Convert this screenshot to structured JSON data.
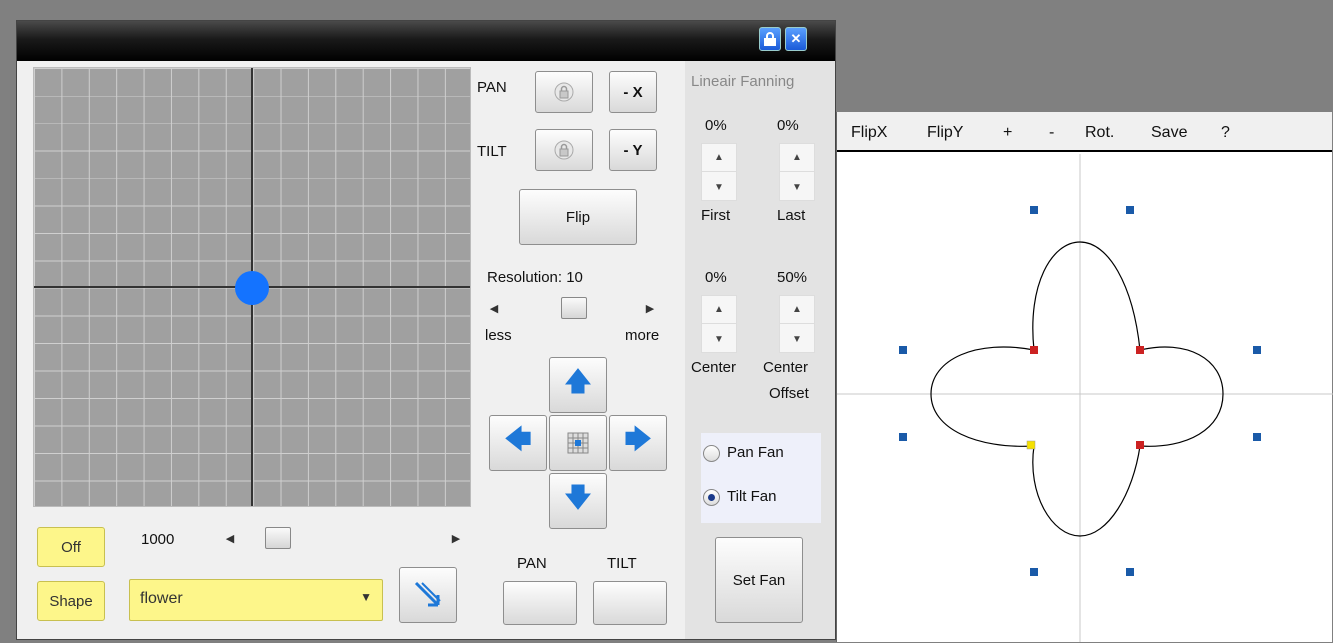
{
  "window": {
    "title_buttons": {
      "lock_icon": "lock-icon",
      "close_icon": "close-icon",
      "close_glyph": "✕"
    }
  },
  "pad": {
    "accent_color": "#1473ff"
  },
  "controls": {
    "pan_label": "PAN",
    "tilt_label": "TILT",
    "minus_x": "- X",
    "minus_y": "- Y",
    "flip": "Flip",
    "resolution_label": "Resolution: 10",
    "less": "less",
    "more": "more",
    "pan_bottom": "PAN",
    "tilt_bottom": "TILT"
  },
  "bottom": {
    "off": "Off",
    "speed_value": "1000",
    "shape": "Shape",
    "shape_selected": "flower",
    "highlight_color": "#fdf68a"
  },
  "fanning": {
    "title": "Lineair Fanning",
    "first_value": "0%",
    "last_value": "0%",
    "first_label": "First",
    "last_label": "Last",
    "center_value": "0%",
    "center_offset_value": "50%",
    "center_label": "Center",
    "center_offset_label_1": "Center",
    "center_offset_label_2": "Offset",
    "pan_fan": "Pan Fan",
    "tilt_fan": "Tilt Fan",
    "tilt_fan_selected": true,
    "set_fan": "Set Fan"
  },
  "editor": {
    "menu": [
      "FlipX",
      "FlipY",
      "+",
      "-",
      "Rot.",
      "Save",
      "?"
    ],
    "point_colors": {
      "handle": "#1a5aa8",
      "selected": "#cc2222",
      "active": "#f5e000"
    }
  }
}
